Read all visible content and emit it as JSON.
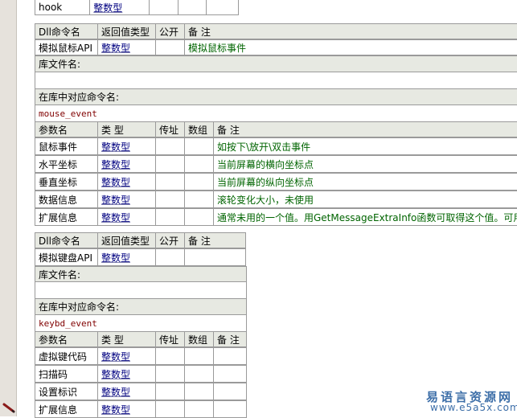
{
  "top_row": {
    "name": "hook",
    "type": "整数型"
  },
  "mouse_cmd": {
    "headers": {
      "name": "Dll命令名",
      "ret": "返回值类型",
      "public": "公开",
      "note": "备 注"
    },
    "name": "模拟鼠标API",
    "ret": "整数型",
    "note": "模拟鼠标事件",
    "lib_label": "库文件名:",
    "lib_value": "",
    "entry_label": "在库中对应命令名:",
    "entry_value": "mouse_event",
    "param_headers": {
      "name": "参数名",
      "type": "类 型",
      "byref": "传址",
      "array": "数组",
      "note": "备 注"
    },
    "params": [
      {
        "name": "鼠标事件",
        "type": "整数型",
        "note": "如按下\\放开\\双击事件"
      },
      {
        "name": "水平坐标",
        "type": "整数型",
        "note": "当前屏幕的横向坐标点"
      },
      {
        "name": "垂直坐标",
        "type": "整数型",
        "note": "当前屏幕的纵向坐标点"
      },
      {
        "name": "数据信息",
        "type": "整数型",
        "note": "滚轮变化大小，未使用"
      },
      {
        "name": "扩展信息",
        "type": "整数型",
        "note": "通常未用的一个值。用GetMessageExtraInfo函数可取得这个值。可用的"
      }
    ]
  },
  "keybd_cmd": {
    "headers": {
      "name": "Dll命令名",
      "ret": "返回值类型",
      "public": "公开",
      "note": "备 注"
    },
    "name": "模拟键盘API",
    "ret": "整数型",
    "note": "",
    "lib_label": "库文件名:",
    "lib_value": "",
    "entry_label": "在库中对应命令名:",
    "entry_value": "keybd_event",
    "param_headers": {
      "name": "参数名",
      "type": "类 型",
      "byref": "传址",
      "array": "数组",
      "note": "备 注"
    },
    "params": [
      {
        "name": "虚拟键代码",
        "type": "整数型",
        "note": ""
      },
      {
        "name": "扫描码",
        "type": "整数型",
        "note": ""
      },
      {
        "name": "设置标识",
        "type": "整数型",
        "note": ""
      },
      {
        "name": "扩展信息",
        "type": "整数型",
        "note": ""
      }
    ]
  },
  "watermark": {
    "title": "易语言资源网",
    "url": "www.e5a5x.com"
  },
  "colors": {
    "header_bg": "#e7e9e2",
    "type_blue": "#000080",
    "note_green": "#006400",
    "cmd_red": "#800000",
    "gutter": "#e6e2dc"
  }
}
